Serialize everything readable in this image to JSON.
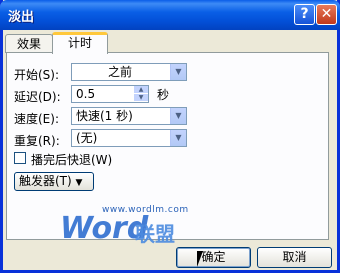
{
  "window": {
    "title": "淡出",
    "help_label": "?",
    "close_label": "✕",
    "titlebar_color": "#0A5FE6"
  },
  "tabs": [
    {
      "label": "效果"
    },
    {
      "label": "计时"
    }
  ],
  "fields": {
    "start_label": "开始(S):",
    "start_value": "之前",
    "delay_label": "延迟(D):",
    "delay_value": "0.5",
    "delay_unit": "秒",
    "speed_label": "速度(E):",
    "speed_value": "快速(1 秒)",
    "repeat_label": "重复(R):",
    "repeat_value": "(无)",
    "rewind_label": "播完后快退(W)",
    "rewind_checked": false,
    "trigger_label": "触发器(T)"
  },
  "watermark": {
    "url": "www.wordlm.com",
    "logo": "Word",
    "cn": "联盟"
  },
  "buttons": {
    "ok_label": "确定",
    "cancel_label": "取消"
  }
}
